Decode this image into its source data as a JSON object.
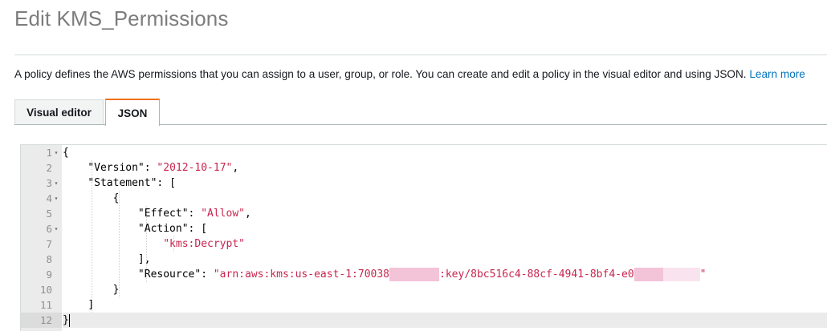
{
  "page": {
    "title": "Edit KMS_Permissions",
    "description": "A policy defines the AWS permissions that you can assign to a user, group, or role. You can create and edit a policy in the visual editor and using JSON.",
    "learn_more": "Learn more"
  },
  "tabs": [
    {
      "label": "Visual editor",
      "active": false
    },
    {
      "label": "JSON",
      "active": true
    }
  ],
  "editor": {
    "active_line": 12,
    "lines": [
      {
        "n": "1",
        "fold": true
      },
      {
        "n": "2",
        "fold": false
      },
      {
        "n": "3",
        "fold": true
      },
      {
        "n": "4",
        "fold": true
      },
      {
        "n": "5",
        "fold": false
      },
      {
        "n": "6",
        "fold": true
      },
      {
        "n": "7",
        "fold": false
      },
      {
        "n": "8",
        "fold": false
      },
      {
        "n": "9",
        "fold": false
      },
      {
        "n": "10",
        "fold": false
      },
      {
        "n": "11",
        "fold": false
      },
      {
        "n": "12",
        "fold": false
      }
    ],
    "code": {
      "open_brace": "{",
      "version_key": "\"Version\"",
      "version_value": "\"2012-10-17\"",
      "statement_key": "\"Statement\"",
      "open_bracket": "[",
      "open_brace_2": "{",
      "effect_key": "\"Effect\"",
      "effect_value": "\"Allow\"",
      "action_key": "\"Action\"",
      "open_bracket_2": "[",
      "action_value": "\"kms:Decrypt\"",
      "close_bracket_comma": "],",
      "resource_key": "\"Resource\"",
      "resource_part1": "\"arn:aws:kms:us-east-1:70038",
      "resource_part2": ":key/8bc516c4-88cf-4941-8bf4-e0",
      "resource_end": "\"",
      "close_brace_2": "}",
      "close_bracket": "]",
      "close_brace": "}"
    }
  },
  "colors": {
    "tab_accent": "#ec7211",
    "link": "#0073bb",
    "string": "#c7254e",
    "redaction": "#f3c3d8"
  }
}
